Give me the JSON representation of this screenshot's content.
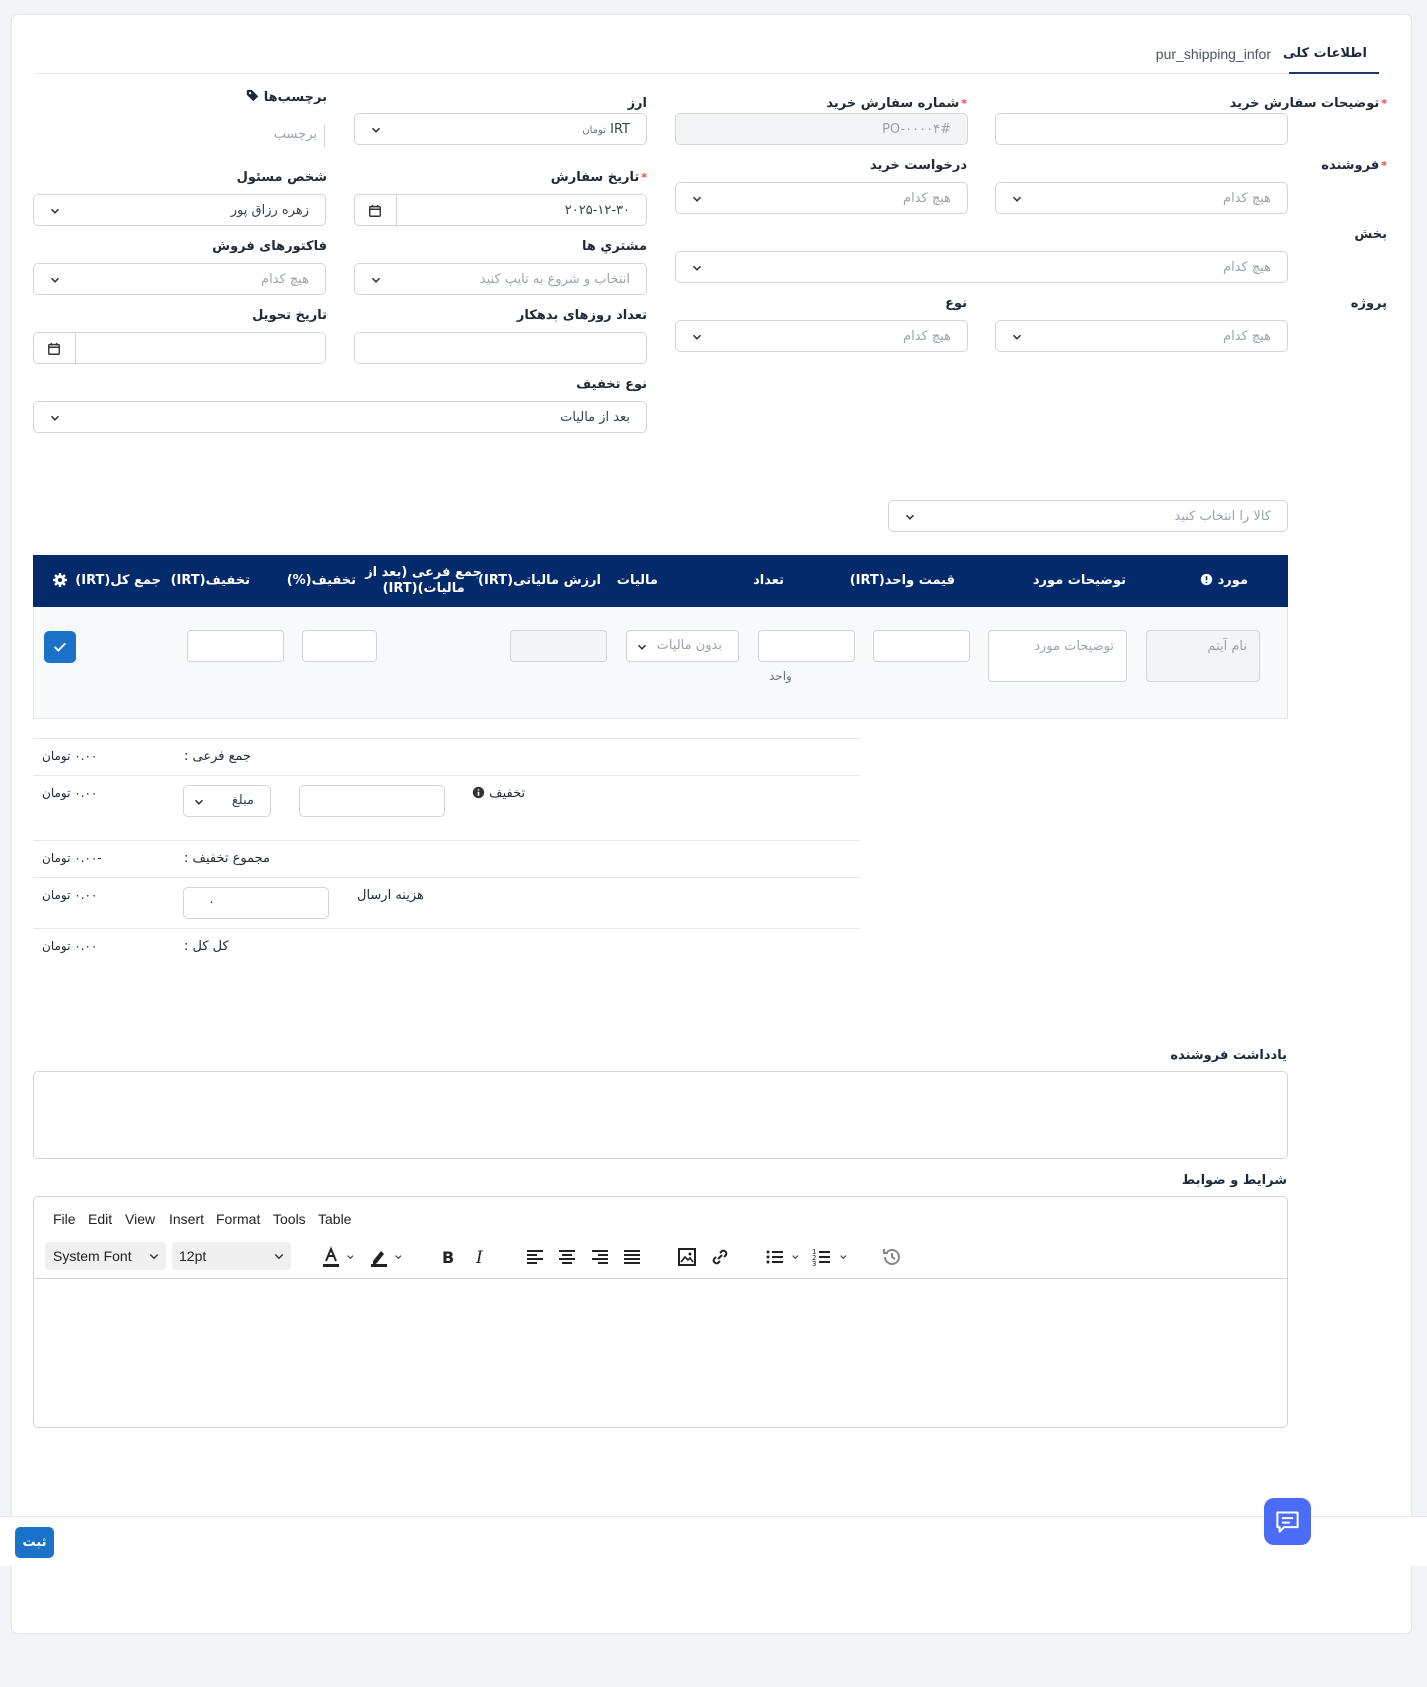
{
  "tabs": [
    {
      "label": "اطلاعات کلی",
      "active": true
    },
    {
      "label": "pur_shipping_infor",
      "active": false
    }
  ],
  "form": {
    "po_description": {
      "label": "توضیحات سفارش خرید",
      "value": ""
    },
    "po_number": {
      "label": "شماره سفارش خرید",
      "value": "PO-۰۰۰۰۴#"
    },
    "currency": {
      "label": "ارز",
      "value": "IRT",
      "suffix": "تومان"
    },
    "tags": {
      "label": "برچسب‌ها",
      "placeholder": "برچسب"
    },
    "vendor": {
      "label": "فروشنده",
      "placeholder": "هیچ کدام"
    },
    "purchase_request": {
      "label": "درخواست خرید",
      "placeholder": "هیچ کدام"
    },
    "order_date": {
      "label": "تاریخ سفارش",
      "value": "۲۰۲۵-۱۲-۳۰"
    },
    "responsible": {
      "label": "شخص مسئول",
      "value": "زهره رزاق پور"
    },
    "department": {
      "label": "بخش",
      "placeholder": "هیچ کدام"
    },
    "customers": {
      "label": "مشتري ها",
      "placeholder": "انتخاب و شروع به تایپ کنید"
    },
    "sales_invoices": {
      "label": "فاکتورهای فروش",
      "placeholder": "هیچ کدام"
    },
    "project": {
      "label": "پروژه",
      "placeholder": "هیچ کدام"
    },
    "type": {
      "label": "نوع",
      "placeholder": "هیچ کدام"
    },
    "debt_days": {
      "label": "تعداد روزهای بدهکار",
      "value": ""
    },
    "delivery_date": {
      "label": "تاریخ تحویل",
      "value": ""
    },
    "discount_type": {
      "label": "نوع تخفیف",
      "value": "بعد از مالیات"
    }
  },
  "item_select": {
    "placeholder": "کالا را انتخاب کنید"
  },
  "table": {
    "headers": {
      "item": "مورد",
      "description": "توضیحات مورد",
      "unit_price": "قیمت واحد(IRT)",
      "qty": "تعداد",
      "tax": "مالیات",
      "tax_value": "ارزش مالیاتی(IRT)",
      "subtotal_line1": "جمع فرعی (بعد از",
      "subtotal_line2": "مالیات)(IRT)",
      "discount_pct": "تخفیف(%)",
      "discount_amt": "تخفیف(IRT)",
      "total": "جمع کل(IRT)"
    },
    "row": {
      "item_placeholder": "نام آیتم",
      "description_placeholder": "توضیحات مورد",
      "unit_label": "واحد",
      "tax_placeholder": "بدون مالیات"
    }
  },
  "summary": {
    "subtotal_label": "جمع فرعی :",
    "subtotal_value": "۰.۰۰ تومان",
    "discount_label": "تخفیف",
    "discount_type": "مبلغ",
    "discount_value": "۰.۰۰ تومان",
    "total_discount_label": "مجموع تخفیف :",
    "total_discount_value": "-۰.۰۰ تومان",
    "shipping_label": "هزینه ارسال",
    "shipping_input": "۰",
    "shipping_value": "۰.۰۰ تومان",
    "grand_total_label": "کل کل :",
    "grand_total_value": "۰.۰۰ تومان"
  },
  "vendor_note": {
    "label": "یادداشت فروشنده"
  },
  "terms": {
    "label": "شرایط و ضوابط"
  },
  "editor": {
    "menu": [
      "File",
      "Edit",
      "View",
      "Insert",
      "Format",
      "Tools",
      "Table"
    ],
    "font": "System Font",
    "size": "12pt"
  },
  "submit_label": "ثبت",
  "colors": {
    "header": "#032a6b",
    "accent": "#1a73c8",
    "required": "#ef4444"
  }
}
